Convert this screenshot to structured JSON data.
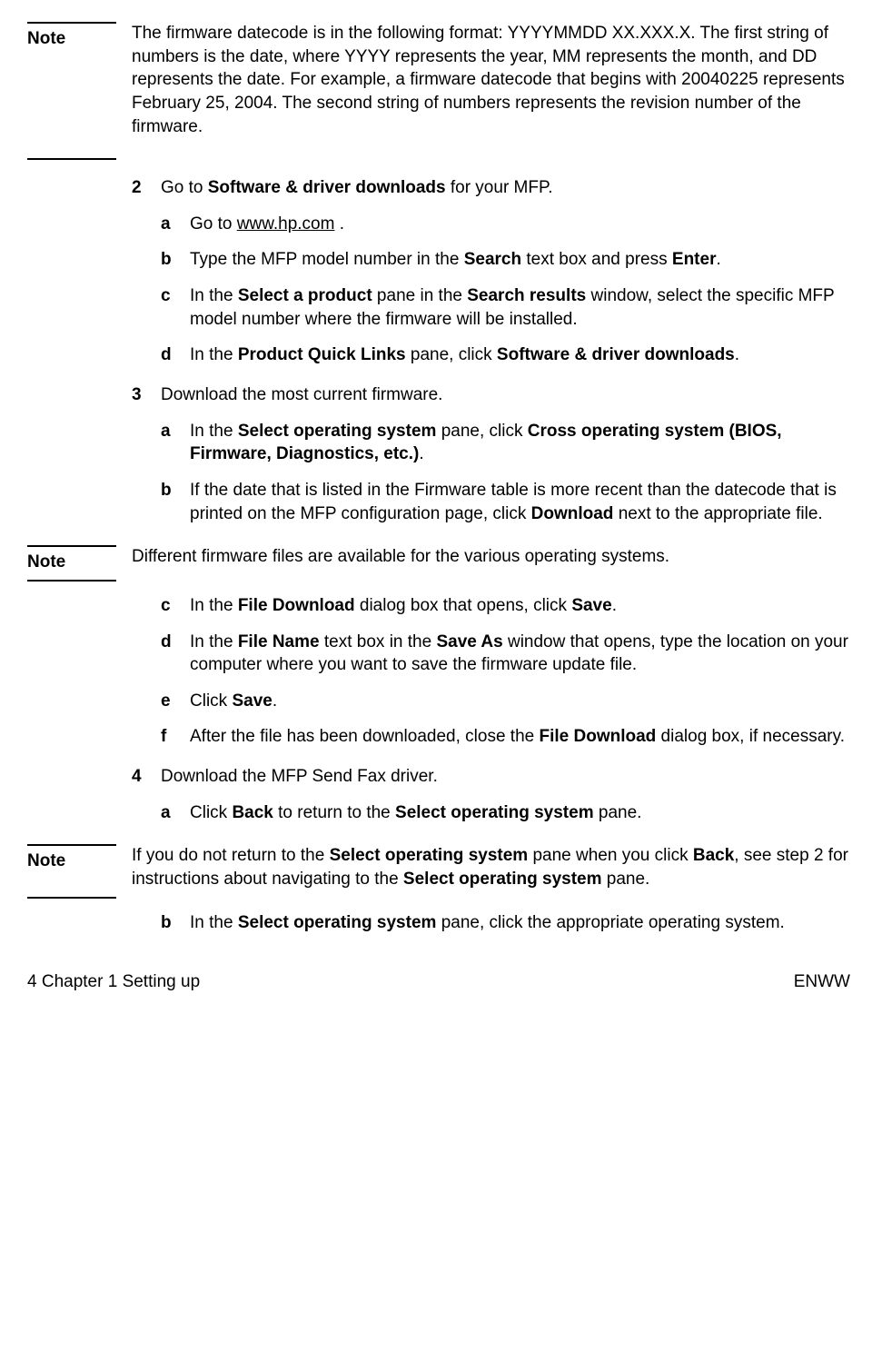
{
  "notes": {
    "n1_label": "Note",
    "n1_text_pre": "The firmware datecode is in the following format: YYYYMMDD XX.XXX.X. The first string of numbers is the date, where YYYY represents the year, MM represents the month, and DD represents the date. For example, a firmware datecode that begins with 20040225 represents February 25, 2004. The second string of numbers represents the revision number of the firmware.",
    "n2_label": "Note",
    "n2_text": "Different firmware files are available for the various operating systems.",
    "n3_label": "Note",
    "n3_pre": "If you do not return to the ",
    "n3_b1": "Select operating system",
    "n3_mid": " pane when you click ",
    "n3_b2": "Back",
    "n3_mid2": ", see step 2 for instructions about navigating to the ",
    "n3_b3": "Select operating system",
    "n3_end": " pane."
  },
  "s2": {
    "num": "2",
    "pre": "Go to ",
    "b1": "Software & driver downloads",
    "post": " for your MFP.",
    "a": {
      "l": "a",
      "pre": "Go to ",
      "link": "www.hp.com",
      "post": " ."
    },
    "b": {
      "l": "b",
      "pre": "Type the MFP model number in the ",
      "b1": "Search",
      "mid": " text box and press ",
      "b2": "Enter",
      "post": "."
    },
    "c": {
      "l": "c",
      "pre": "In the ",
      "b1": "Select a product",
      "mid": " pane in the ",
      "b2": "Search results",
      "post": " window, select the specific MFP model number where the firmware will be installed."
    },
    "d": {
      "l": "d",
      "pre": "In the ",
      "b1": "Product Quick Links",
      "mid": " pane, click ",
      "b2": "Software & driver downloads",
      "post": "."
    }
  },
  "s3": {
    "num": "3",
    "text": "Download the most current firmware.",
    "a": {
      "l": "a",
      "pre": "In the ",
      "b1": "Select operating system",
      "mid": " pane, click ",
      "b2": "Cross operating system (BIOS, Firmware, Diagnostics, etc.)",
      "post": "."
    },
    "b": {
      "l": "b",
      "pre": "If the date that is listed in the Firmware table is more recent than the datecode that is printed on the MFP configuration page, click ",
      "b1": "Download",
      "post": " next to the appropriate file."
    },
    "c": {
      "l": "c",
      "pre": "In the ",
      "b1": "File Download",
      "mid": " dialog box that opens, click ",
      "b2": "Save",
      "post": "."
    },
    "d": {
      "l": "d",
      "pre": "In the ",
      "b1": "File Name",
      "mid": " text box in the ",
      "b2": "Save As",
      "post": " window that opens, type the location on your computer where you want to save the firmware update file."
    },
    "e": {
      "l": "e",
      "pre": "Click ",
      "b1": "Save",
      "post": "."
    },
    "f": {
      "l": "f",
      "pre": "After the file has been downloaded, close the ",
      "b1": "File Download",
      "post": " dialog box, if necessary."
    }
  },
  "s4": {
    "num": "4",
    "text": "Download the MFP Send Fax driver.",
    "a": {
      "l": "a",
      "pre": "Click ",
      "b1": "Back",
      "mid": " to return to the ",
      "b2": "Select operating system",
      "post": " pane."
    },
    "b": {
      "l": "b",
      "pre": "In the ",
      "b1": "Select operating system",
      "post": " pane, click the appropriate operating system."
    }
  },
  "footer": {
    "left": "4 Chapter 1 Setting up",
    "right": "ENWW"
  }
}
